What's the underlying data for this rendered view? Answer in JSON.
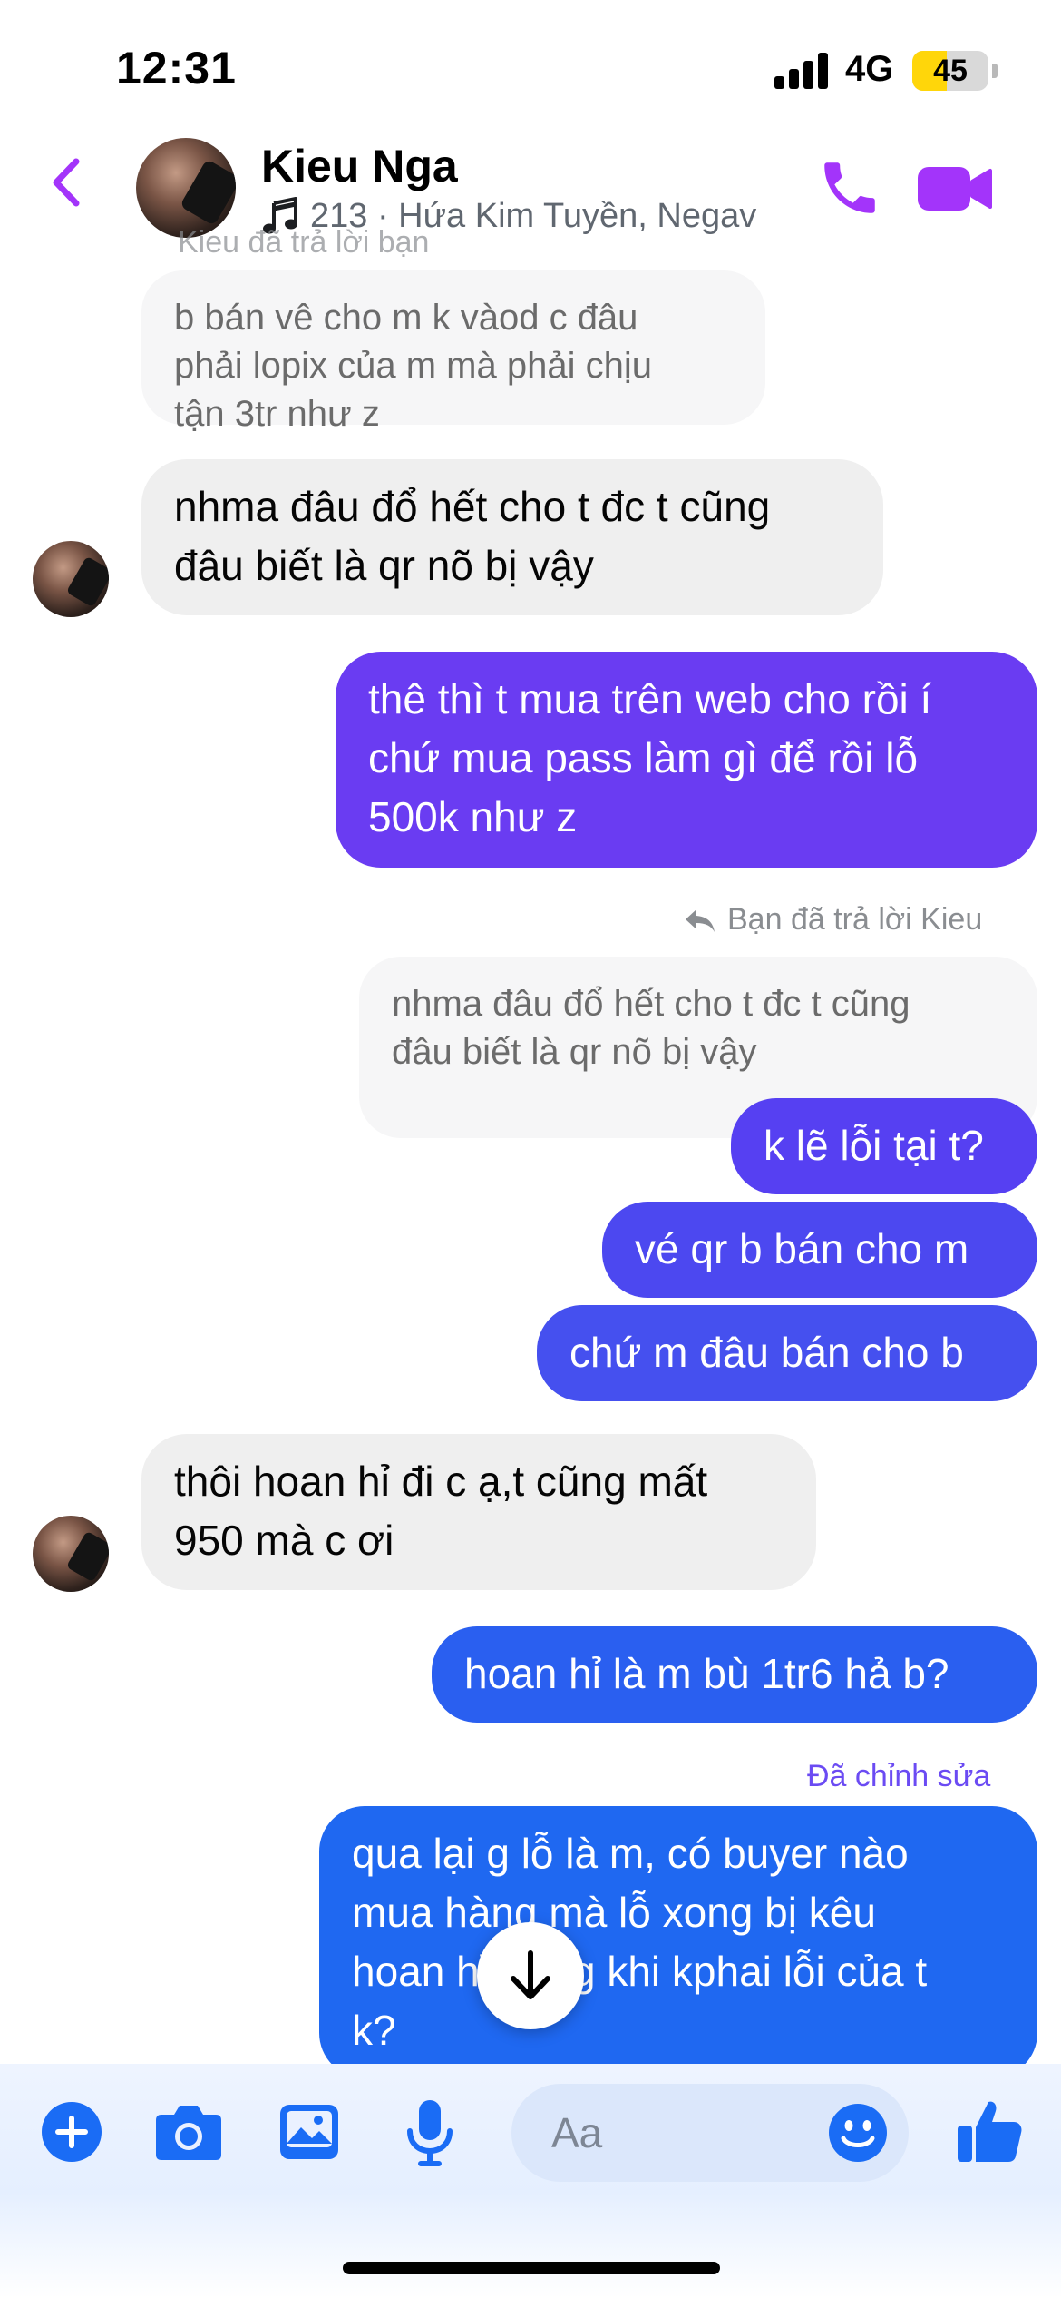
{
  "status_bar": {
    "time": "12:31",
    "network": "4G",
    "battery": "45",
    "battery_level": 0.45,
    "battery_color": "#ffd60a"
  },
  "header": {
    "contact_name": "Kieu Nga",
    "contact_status": "213 · Hứa Kim Tuyền, Negav",
    "accent_color": "#a334fa",
    "icons": [
      "back-chevron-icon",
      "music-note-icon",
      "phone-icon",
      "video-camera-icon"
    ]
  },
  "messages": [
    {
      "id": "m0_meta",
      "type": "reply_meta",
      "text": "Kieu đã trả lời bạn"
    },
    {
      "id": "m0_quote",
      "type": "quoted",
      "text": [
        "b bán vê cho m k vàod c đâu",
        "phải lopix của m mà phải chịu",
        "tận 3tr như z"
      ]
    },
    {
      "id": "m1",
      "type": "incoming",
      "text": [
        "nhma đâu đổ hết cho t đc t cũng",
        "đâu biết là qr nõ bị vậy"
      ]
    },
    {
      "id": "m2",
      "type": "outgoing",
      "color": "#6a3cf2",
      "text": [
        "thê thì t mua trên web cho rồi í",
        "chứ mua pass làm gì để rồi lỗ",
        "500k như z"
      ]
    },
    {
      "id": "m3_meta",
      "type": "reply_meta",
      "text": "Bạn đã trả lời Kieu"
    },
    {
      "id": "m3_quote",
      "type": "quoted",
      "text": [
        "nhma đâu đổ hết cho t đc t cũng",
        "đâu biết là qr nõ bị vậy"
      ]
    },
    {
      "id": "m3",
      "type": "outgoing",
      "color": "#5640f2",
      "text": [
        "k lẽ lỗi tại t?"
      ]
    },
    {
      "id": "m4",
      "type": "outgoing",
      "color": "#4c48f0",
      "text": [
        "vé qr b bán cho m"
      ]
    },
    {
      "id": "m5",
      "type": "outgoing",
      "color": "#4550ef",
      "text": [
        "chứ m đâu bán cho b"
      ]
    },
    {
      "id": "m6",
      "type": "incoming",
      "text": [
        "thôi hoan hỉ đi c ạ,t cũng mất",
        "950 mà c ơi"
      ]
    },
    {
      "id": "m7",
      "type": "outgoing",
      "color": "#2a5ff0",
      "text": [
        "hoan hỉ là m  bù 1tr6 hả b?"
      ]
    },
    {
      "id": "m8_meta",
      "type": "edited",
      "text": "Đã chỉnh sửa"
    },
    {
      "id": "m8",
      "type": "outgoing",
      "color": "#1f68f1",
      "text": [
        "qua lại g lỗ là m, có buyer nào",
        "mua hàng mà lỗ xong bị kêu",
        "hoan hỉ trong khi kphai lỗi của t",
        "k?"
      ]
    }
  ],
  "composer": {
    "placeholder": "Aa",
    "accent_color": "#1a6cf5",
    "icons": [
      "plus-icon",
      "camera-icon",
      "image-icon",
      "microphone-icon",
      "emoji-icon",
      "thumbs-up-icon"
    ]
  },
  "scroll_down_icon": "arrow-down-icon"
}
